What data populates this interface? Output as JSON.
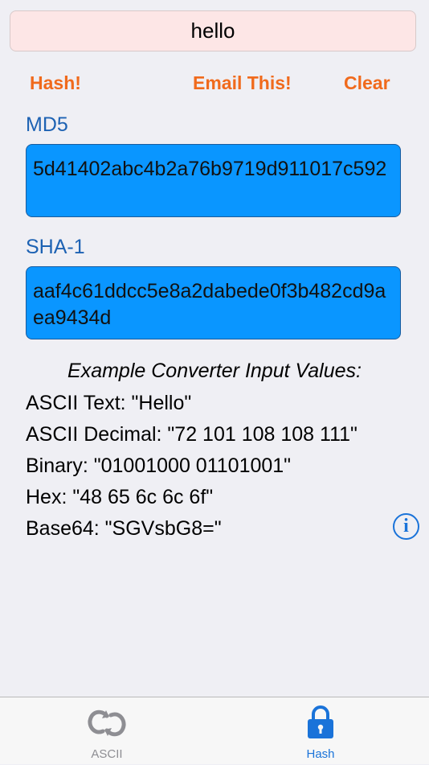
{
  "input": {
    "value": "hello"
  },
  "actions": {
    "hash": "Hash!",
    "email": "Email This!",
    "clear": "Clear"
  },
  "md5": {
    "label": "MD5",
    "value": "5d41402abc4b2a76b9719d911017c592"
  },
  "sha1": {
    "label": "SHA-1",
    "value": "aaf4c61ddcc5e8a2dabede0f3b482cd9aea9434d"
  },
  "examples": {
    "title": "Example Converter Input Values:",
    "lines": [
      "ASCII Text: \"Hello\"",
      "ASCII Decimal: \"72 101 108 108 111\"",
      "Binary: \"01001000 01101001\"",
      "Hex: \"48 65 6c 6c 6f\"",
      "Base64: \"SGVsbG8=\""
    ]
  },
  "info": {
    "glyph": "i"
  },
  "tabs": [
    {
      "label": "ASCII",
      "icon": "refresh-icon",
      "active": false
    },
    {
      "label": "Hash",
      "icon": "lock-icon",
      "active": true
    }
  ],
  "colors": {
    "accent_orange": "#f06a1c",
    "label_blue": "#1d62b3",
    "hash_box_blue": "#0a96ff",
    "tab_active": "#1a73d9",
    "tab_inactive": "#8e8e93"
  }
}
